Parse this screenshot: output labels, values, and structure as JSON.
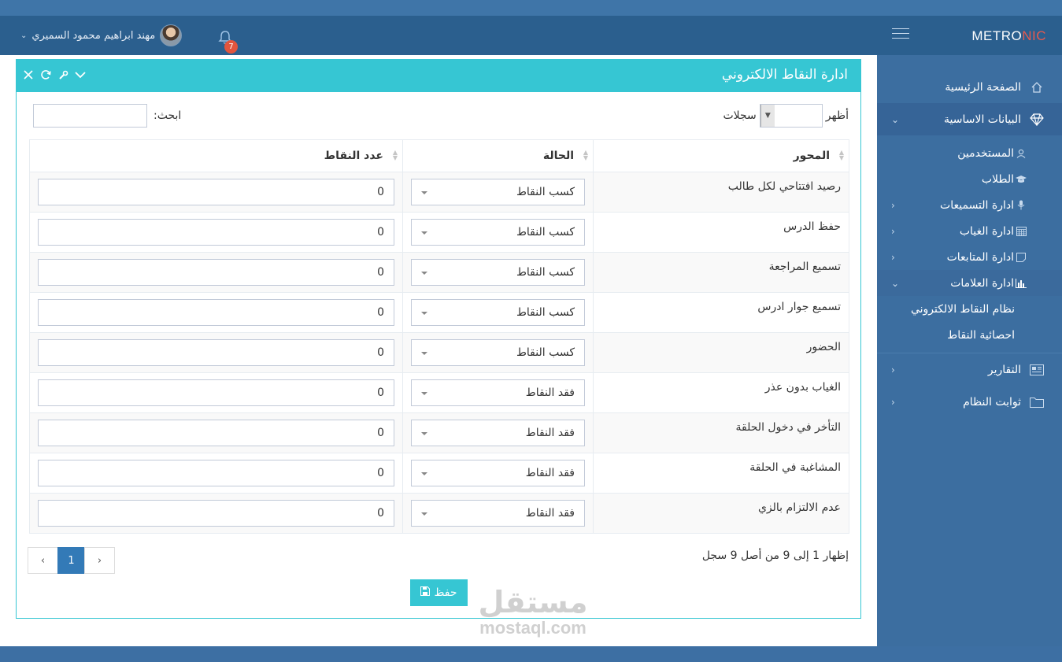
{
  "brand": {
    "logo_main": "METRO",
    "logo_accent": "NIC",
    "accent_color": "#e65a4f"
  },
  "header": {
    "user_name": "مهند ابراهيم محمود السميري",
    "notifications_count": "7"
  },
  "sidebar": {
    "home": "الصفحة الرئيسية",
    "basic_data": "البيانات الاساسية",
    "users": "المستخدمين",
    "students": "الطلاب",
    "recitations": "ادارة التسميعات",
    "absence": "ادارة الغياب",
    "followups": "ادارة المتابعات",
    "marks": "ادارة العلامات",
    "points_system": "نظام النقاط الالكتروني",
    "points_stats": "احصائية النقاط",
    "reports": "التقارير",
    "system_constants": "ثوابت النظام"
  },
  "portlet": {
    "title": "ادارة النقاط الالكتروني"
  },
  "table_controls": {
    "show_label": "أظهر",
    "records_label": "سجلات",
    "search_label": "ابحث:"
  },
  "table": {
    "headers": {
      "axis": "المحور",
      "state": "الحالة",
      "points": "عدد النقاط"
    },
    "rows": [
      {
        "axis": "رصيد افتتاحي لكل طالب",
        "state": "كسب النقاط",
        "points": "0"
      },
      {
        "axis": "حفظ الدرس",
        "state": "كسب النقاط",
        "points": "0"
      },
      {
        "axis": "تسميع المراجعة",
        "state": "كسب النقاط",
        "points": "0"
      },
      {
        "axis": "تسميع جوار ادرس",
        "state": "كسب النقاط",
        "points": "0"
      },
      {
        "axis": "الحضور",
        "state": "كسب النقاط",
        "points": "0"
      },
      {
        "axis": "الغياب بدون عذر",
        "state": "فقد النقاط",
        "points": "0"
      },
      {
        "axis": "التأخر في دخول الحلقة",
        "state": "فقد النقاط",
        "points": "0"
      },
      {
        "axis": "المشاغبة في الحلقة",
        "state": "فقد النقاط",
        "points": "0"
      },
      {
        "axis": "عدم الالتزام بالزي",
        "state": "فقد النقاط",
        "points": "0"
      }
    ]
  },
  "footer": {
    "info": "إظهار 1 إلى 9 من أصل 9 سجل",
    "page_prev": "‹",
    "page_current": "1",
    "page_next": "›",
    "save_label": "حفظ"
  },
  "watermark": {
    "arabic": "مستقل",
    "latin": "mostaql.com"
  }
}
